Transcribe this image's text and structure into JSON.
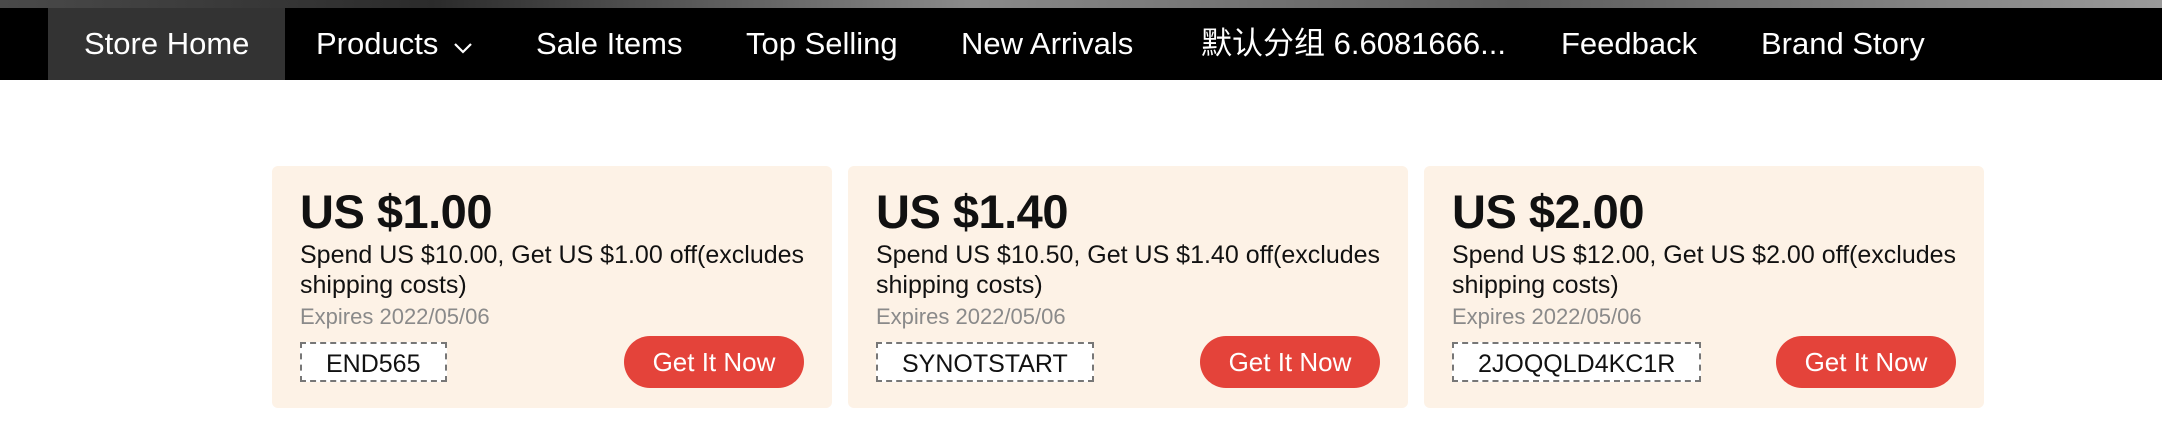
{
  "nav": {
    "items": [
      {
        "label": "Store Home"
      },
      {
        "label": "Products"
      },
      {
        "label": "Sale Items"
      },
      {
        "label": "Top Selling"
      },
      {
        "label": "New Arrivals"
      },
      {
        "label": "默认分组 6.6081666..."
      },
      {
        "label": "Feedback"
      },
      {
        "label": "Brand Story"
      }
    ]
  },
  "coupons": [
    {
      "amount": "US $1.00",
      "description": "Spend US $10.00, Get US $1.00 off(excludes shipping costs)",
      "expires": "Expires 2022/05/06",
      "code": "END565",
      "button": "Get It Now"
    },
    {
      "amount": "US $1.40",
      "description": "Spend US $10.50, Get US $1.40 off(excludes shipping costs)",
      "expires": "Expires 2022/05/06",
      "code": "SYNOTSTART",
      "button": "Get It Now"
    },
    {
      "amount": "US $2.00",
      "description": "Spend US $12.00, Get US $2.00 off(excludes shipping costs)",
      "expires": "Expires 2022/05/06",
      "code": "2JOQQLD4KC1R",
      "button": "Get It Now"
    }
  ],
  "colors": {
    "nav_bg": "#000000",
    "nav_active_bg": "#333333",
    "coupon_bg": "#fdf2e6",
    "button_bg": "#e4433a"
  }
}
